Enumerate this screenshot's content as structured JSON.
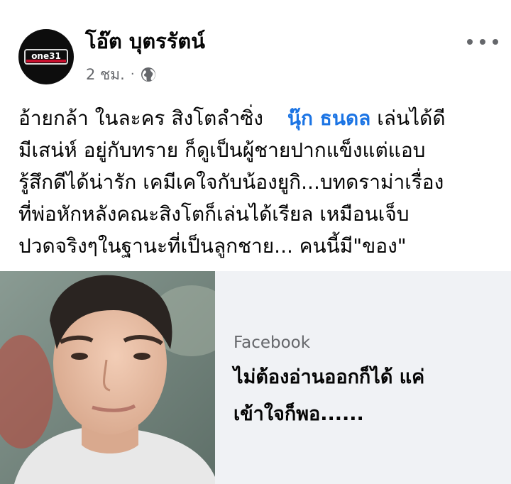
{
  "post": {
    "author": "โอ๊ต บุตรรัตน์",
    "avatar_logo_text": "one31",
    "time": "2 ชม.",
    "separator": "·",
    "privacy_icon": "globe-icon",
    "more_icon": "more-horizontal-icon",
    "text_lines": [
      "อ้ายกล้า ในละคร สิงโตลำซิ่ง",
      "มีเสน่ห์ อยู่กับทราย ก็ดูเป็นผู้ชายปากแข็งแต่แอบ",
      "รู้สึกดีได้น่ารัก เคมีเคใจกับน้องยูกิ...บทดราม่าเรื่อง",
      "ที่พ่อหักหลังคณะสิงโตก็เล่นได้เรียล เหมือนเจ็บ",
      "ปวดจริงๆในฐานะที่เป็นลูกชาย... คนนี้มี\"ของ\""
    ],
    "mention": "นุ๊ก ธนดล",
    "line1_suffix": " เล่นได้ดี"
  },
  "link_card": {
    "source": "Facebook",
    "title_lines": [
      "ไม่ต้องอ่านออกก็ได้ แค่",
      "เข้าใจก็พอ......"
    ]
  },
  "colors": {
    "mention": "#1b74e4",
    "secondary_text": "#65676b",
    "card_bg": "#f0f2f5"
  }
}
